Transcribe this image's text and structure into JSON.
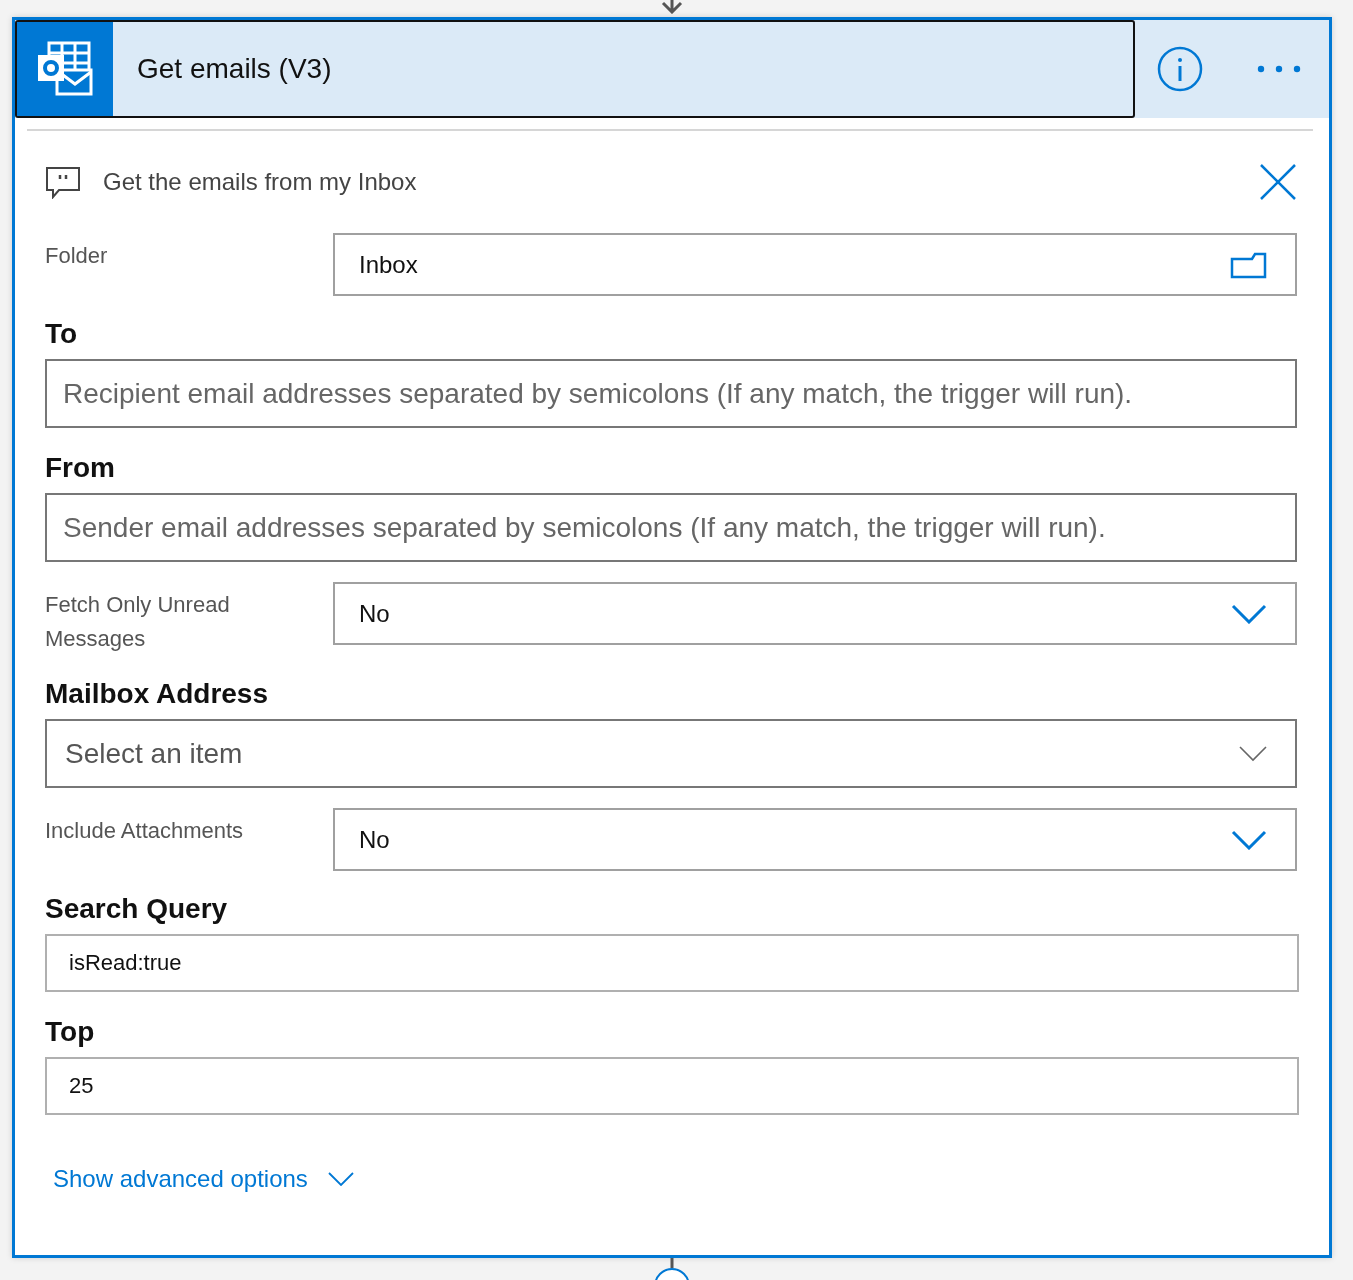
{
  "card": {
    "title": "Get emails (V3)",
    "description": "Get the emails from my Inbox",
    "fields": [
      {
        "label": "Folder",
        "kind": "inline",
        "control": {
          "kind": "picker",
          "value": "Inbox"
        }
      },
      {
        "label": "To",
        "kind": "stacked",
        "control": {
          "kind": "text",
          "placeholder": "Recipient email addresses separated by semicolons (If any match, the trigger will run)."
        }
      },
      {
        "label": "From",
        "kind": "stacked",
        "control": {
          "kind": "text",
          "placeholder": "Sender email addresses separated by semicolons (If any match, the trigger will run)."
        }
      },
      {
        "label": "Fetch Only Unread Messages",
        "kind": "inline",
        "control": {
          "kind": "dropdown",
          "value": "No"
        }
      },
      {
        "label": "Mailbox Address",
        "kind": "stacked",
        "control": {
          "kind": "select",
          "placeholder": "Select an item"
        }
      },
      {
        "label": "Include Attachments",
        "kind": "inline",
        "control": {
          "kind": "dropdown",
          "value": "No"
        }
      },
      {
        "label": "Search Query",
        "kind": "stacked",
        "control": {
          "kind": "text",
          "value": "isRead:true"
        }
      },
      {
        "label": "Top",
        "kind": "stacked",
        "control": {
          "kind": "text",
          "value": "25"
        }
      }
    ],
    "advanced_link": "Show advanced options"
  }
}
